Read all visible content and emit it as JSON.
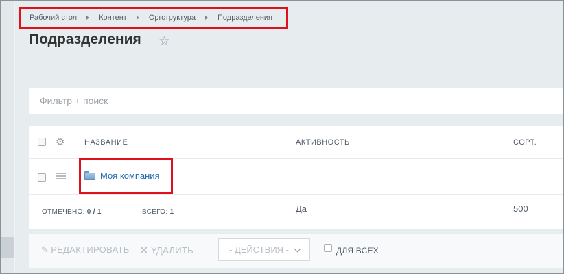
{
  "breadcrumb": [
    "Рабочий стол",
    "Контент",
    "Оргструктура",
    "Подразделения"
  ],
  "page": {
    "title": "Подразделения"
  },
  "filter": {
    "placeholder": "Фильтр + поиск"
  },
  "table": {
    "columns": [
      "НАЗВАНИЕ",
      "АКТИВНОСТЬ",
      "СОРТ."
    ],
    "rows": [
      {
        "name": "Моя компания",
        "active": "Да",
        "sort": "500"
      }
    ]
  },
  "footer": {
    "marked_label": "ОТМЕЧЕНО:",
    "marked_value": "0 / 1",
    "total_label": "ВСЕГО:",
    "total_value": "1"
  },
  "actions": {
    "edit": "РЕДАКТИРОВАТЬ",
    "delete": "УДАЛИТЬ",
    "select": "- ДЕЙСТВИЯ -",
    "for_all": "ДЛЯ ВСЕХ"
  },
  "icons": [
    "star-icon",
    "gear-icon",
    "menu-icon",
    "folder-icon",
    "pencil-icon",
    "x-icon",
    "chevron-down-icon"
  ],
  "colors": {
    "highlight": "#e0101f",
    "link": "#2067b0"
  }
}
